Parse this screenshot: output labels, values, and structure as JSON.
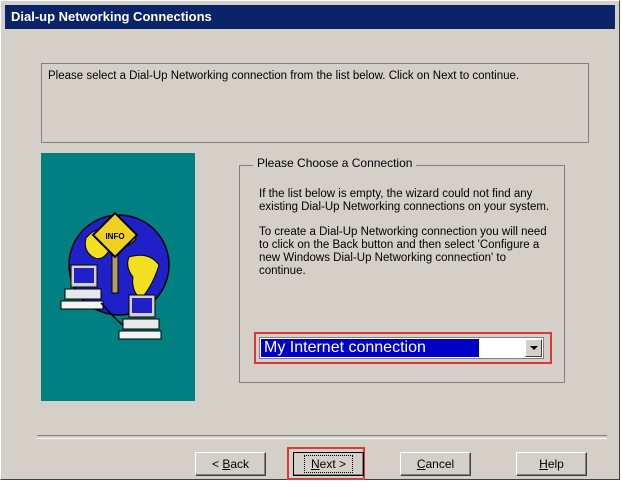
{
  "dialog": {
    "title": "Dial-up Networking Connections",
    "instruction": "Please select a Dial-Up Networking connection from the list below.  Click on Next to continue."
  },
  "group": {
    "title": "Please Choose a Connection",
    "paragraph1": "If the list below is empty, the wizard could not find any existing Dial-Up Networking connections on your system.",
    "paragraph2": "To create a Dial-Up Networking connection you will need to click on the Back button and then select 'Configure a new Windows Dial-Up Networking connection' to continue."
  },
  "connection_select": {
    "selected": "My Internet connection"
  },
  "image": {
    "sign_text": "INFO"
  },
  "buttons": {
    "back": {
      "mnemonic": "B",
      "prefix": "< ",
      "rest": "ack"
    },
    "next": {
      "mnemonic": "N",
      "rest": "ext >"
    },
    "cancel": {
      "mnemonic": "C",
      "rest": "ancel"
    },
    "help": {
      "mnemonic": "H",
      "rest": "elp"
    }
  },
  "colors": {
    "titlebar": "#0a246a",
    "dialog_face": "#d4d0c8",
    "image_background": "#008080",
    "selection": "#0000c8",
    "highlight_outline": "#d83a3a"
  }
}
